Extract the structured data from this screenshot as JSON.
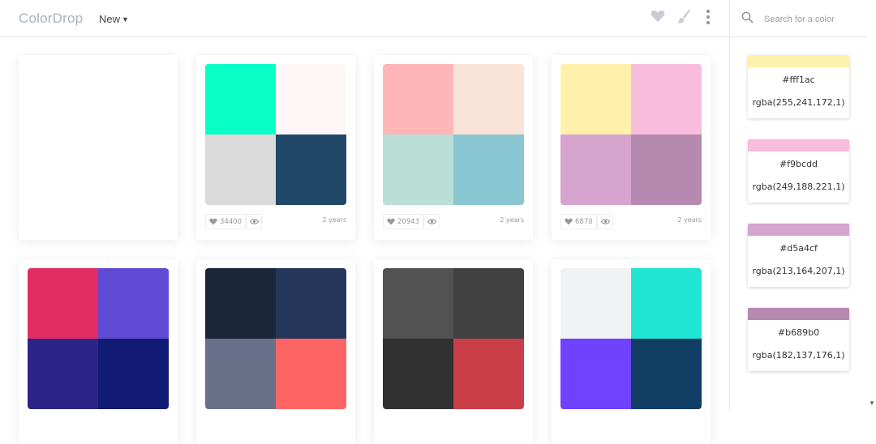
{
  "header": {
    "logo": "ColorDrop",
    "nav_new": "New"
  },
  "top_icons": {
    "heart": "heart-icon",
    "brush": "brush-icon",
    "more": "more-vertical-icon"
  },
  "search": {
    "placeholder": "Search for a color"
  },
  "palettes": [
    {
      "blank": true
    },
    {
      "colors": [
        "#08ffc8",
        "#fff7f7",
        "#dadada",
        "#204969"
      ],
      "likes": "34400",
      "age": "2 years"
    },
    {
      "colors": [
        "#ffb6b9",
        "#fae3d9",
        "#bbded6",
        "#8ac6d1"
      ],
      "likes": "20943",
      "age": "2 years"
    },
    {
      "colors": [
        "#fff1ac",
        "#f9bcdd",
        "#d5a4cf",
        "#b689b0"
      ],
      "likes": "6870",
      "age": "2 years"
    },
    {
      "colors": [
        "#e42c64",
        "#614ad3",
        "#2d248a",
        "#121b74"
      ]
    },
    {
      "colors": [
        "#1a2639",
        "#243659",
        "#687189",
        "#ff6464"
      ]
    },
    {
      "colors": [
        "#525252",
        "#414141",
        "#313131",
        "#ca3e47"
      ]
    },
    {
      "colors": [
        "#f0f2f3",
        "#1fe5d2",
        "#6f42ff",
        "#0f3d64"
      ]
    }
  ],
  "selected_swatches": [
    {
      "strip": "#fff1ac",
      "hex": "#fff1ac",
      "rgba": "rgba(255,241,172,1)"
    },
    {
      "strip": "#f9bcdd",
      "hex": "#f9bcdd",
      "rgba": "rgba(249,188,221,1)"
    },
    {
      "strip": "#d5a4cf",
      "hex": "#d5a4cf",
      "rgba": "rgba(213,164,207,1)"
    },
    {
      "strip": "#b689b0",
      "hex": "#b689b0",
      "rgba": "rgba(182,137,176,1)"
    }
  ]
}
